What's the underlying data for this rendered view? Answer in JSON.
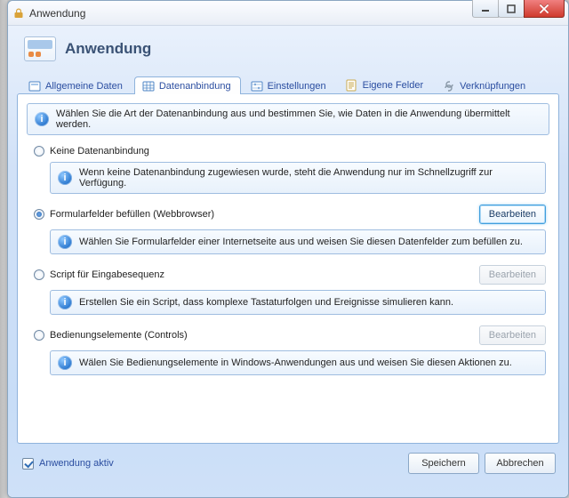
{
  "window": {
    "title": "Anwendung"
  },
  "header": {
    "title": "Anwendung"
  },
  "tabs": {
    "general": "Allgemeine Daten",
    "data_binding": "Datenanbindung",
    "settings": "Einstellungen",
    "custom_fields": "Eigene Felder",
    "links": "Verknüpfungen",
    "active_index": 1
  },
  "intro": "Wählen Sie die Art der Datenanbindung aus und bestimmen Sie, wie Daten in die Anwendung übermittelt werden.",
  "options": {
    "none": {
      "label": "Keine Datenanbindung",
      "info": "Wenn keine Datenanbindung zugewiesen wurde, steht die Anwendung nur im Schnellzugriff zur Verfügung."
    },
    "form_fields": {
      "label": "Formularfelder befüllen (Webbrowser)",
      "info": "Wählen Sie Formularfelder einer Internetseite aus und weisen Sie diesen Datenfelder zum befüllen zu.",
      "edit": "Bearbeiten"
    },
    "script": {
      "label": "Script für Eingabesequenz",
      "info": "Erstellen Sie ein Script, dass komplexe Tastaturfolgen und Ereignisse simulieren kann.",
      "edit": "Bearbeiten"
    },
    "controls": {
      "label": "Bedienungselemente (Controls)",
      "info": "Wälen Sie Bedienungselemente in Windows-Anwendungen aus und weisen Sie diesen Aktionen zu.",
      "edit": "Bearbeiten"
    },
    "selected": "form_fields"
  },
  "footer": {
    "active_label": "Anwendung aktiv",
    "save": "Speichern",
    "cancel": "Abbrechen"
  }
}
